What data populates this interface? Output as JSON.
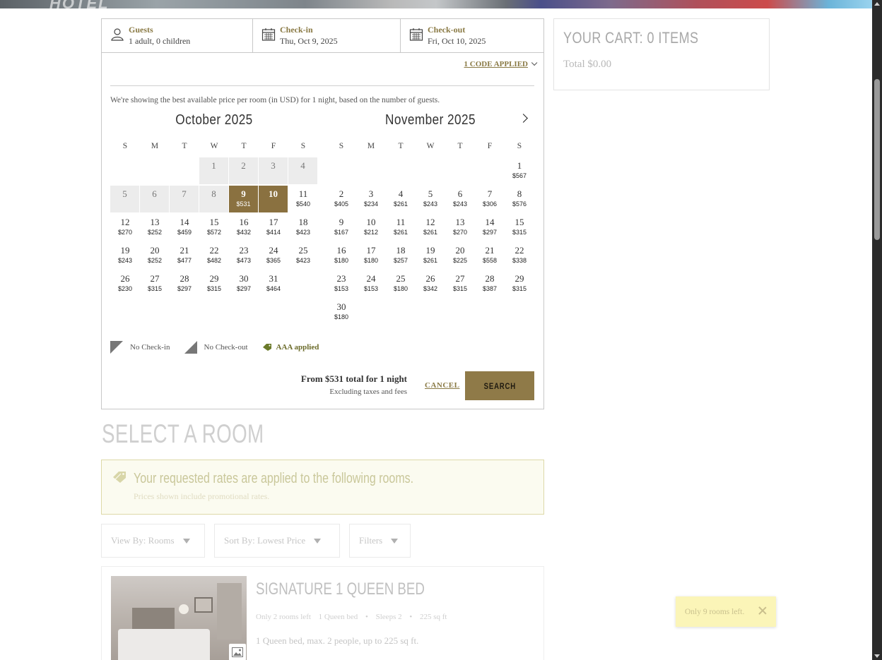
{
  "hero": {
    "text": "HOTEL"
  },
  "booking": {
    "guests": {
      "label": "Guests",
      "value": "1 adult, 0 children"
    },
    "checkin": {
      "label": "Check-in",
      "value": "Thu, Oct 9, 2025"
    },
    "checkout": {
      "label": "Check-out",
      "value": "Fri, Oct 10, 2025"
    },
    "codes_link": "1 CODE APPLIED",
    "note": "We're showing the best available price per room (in USD) for 1 night, based on the number of guests.",
    "weekdays": [
      "S",
      "M",
      "T",
      "W",
      "T",
      "F",
      "S"
    ],
    "months": [
      {
        "title": "October 2025",
        "lead_blanks": 3,
        "days": [
          {
            "n": "1",
            "p": "",
            "state": "past"
          },
          {
            "n": "2",
            "p": "",
            "state": "past"
          },
          {
            "n": "3",
            "p": "",
            "state": "past"
          },
          {
            "n": "4",
            "p": "",
            "state": "past"
          },
          {
            "n": "5",
            "p": "",
            "state": "past"
          },
          {
            "n": "6",
            "p": "",
            "state": "past"
          },
          {
            "n": "7",
            "p": "",
            "state": "past"
          },
          {
            "n": "8",
            "p": "",
            "state": "past"
          },
          {
            "n": "9",
            "p": "$531",
            "state": "sel"
          },
          {
            "n": "10",
            "p": "",
            "state": "sel"
          },
          {
            "n": "11",
            "p": "$540",
            "state": ""
          },
          {
            "n": "12",
            "p": "$270",
            "state": ""
          },
          {
            "n": "13",
            "p": "$252",
            "state": ""
          },
          {
            "n": "14",
            "p": "$459",
            "state": ""
          },
          {
            "n": "15",
            "p": "$572",
            "state": ""
          },
          {
            "n": "16",
            "p": "$432",
            "state": ""
          },
          {
            "n": "17",
            "p": "$414",
            "state": ""
          },
          {
            "n": "18",
            "p": "$423",
            "state": ""
          },
          {
            "n": "19",
            "p": "$243",
            "state": ""
          },
          {
            "n": "20",
            "p": "$252",
            "state": ""
          },
          {
            "n": "21",
            "p": "$477",
            "state": ""
          },
          {
            "n": "22",
            "p": "$482",
            "state": ""
          },
          {
            "n": "23",
            "p": "$473",
            "state": ""
          },
          {
            "n": "24",
            "p": "$365",
            "state": ""
          },
          {
            "n": "25",
            "p": "$423",
            "state": ""
          },
          {
            "n": "26",
            "p": "$230",
            "state": ""
          },
          {
            "n": "27",
            "p": "$315",
            "state": ""
          },
          {
            "n": "28",
            "p": "$297",
            "state": ""
          },
          {
            "n": "29",
            "p": "$315",
            "state": ""
          },
          {
            "n": "30",
            "p": "$297",
            "state": ""
          },
          {
            "n": "31",
            "p": "$464",
            "state": ""
          }
        ]
      },
      {
        "title": "November 2025",
        "lead_blanks": 6,
        "days": [
          {
            "n": "1",
            "p": "$567",
            "state": ""
          },
          {
            "n": "2",
            "p": "$405",
            "state": ""
          },
          {
            "n": "3",
            "p": "$234",
            "state": ""
          },
          {
            "n": "4",
            "p": "$261",
            "state": ""
          },
          {
            "n": "5",
            "p": "$243",
            "state": ""
          },
          {
            "n": "6",
            "p": "$243",
            "state": ""
          },
          {
            "n": "7",
            "p": "$306",
            "state": ""
          },
          {
            "n": "8",
            "p": "$576",
            "state": ""
          },
          {
            "n": "9",
            "p": "$167",
            "state": ""
          },
          {
            "n": "10",
            "p": "$212",
            "state": ""
          },
          {
            "n": "11",
            "p": "$261",
            "state": ""
          },
          {
            "n": "12",
            "p": "$261",
            "state": ""
          },
          {
            "n": "13",
            "p": "$270",
            "state": ""
          },
          {
            "n": "14",
            "p": "$297",
            "state": ""
          },
          {
            "n": "15",
            "p": "$315",
            "state": ""
          },
          {
            "n": "16",
            "p": "$180",
            "state": ""
          },
          {
            "n": "17",
            "p": "$180",
            "state": ""
          },
          {
            "n": "18",
            "p": "$257",
            "state": ""
          },
          {
            "n": "19",
            "p": "$261",
            "state": ""
          },
          {
            "n": "20",
            "p": "$225",
            "state": ""
          },
          {
            "n": "21",
            "p": "$558",
            "state": ""
          },
          {
            "n": "22",
            "p": "$338",
            "state": ""
          },
          {
            "n": "23",
            "p": "$153",
            "state": ""
          },
          {
            "n": "24",
            "p": "$153",
            "state": ""
          },
          {
            "n": "25",
            "p": "$180",
            "state": ""
          },
          {
            "n": "26",
            "p": "$342",
            "state": ""
          },
          {
            "n": "27",
            "p": "$315",
            "state": ""
          },
          {
            "n": "28",
            "p": "$387",
            "state": ""
          },
          {
            "n": "29",
            "p": "$315",
            "state": ""
          },
          {
            "n": "30",
            "p": "$180",
            "state": ""
          }
        ]
      }
    ],
    "legend": {
      "no_checkin": "No Check-in",
      "no_checkout": "No Check-out",
      "aaa": "AAA applied"
    },
    "from_text": "From $531 total for 1 night",
    "excluding_text": "Excluding taxes and fees",
    "cancel_label": "CANCEL",
    "search_label": "SEARCH"
  },
  "cart": {
    "title": "YOUR CART: 0 ITEMS",
    "total": "Total $0.00"
  },
  "select_room": {
    "heading": "SELECT A ROOM"
  },
  "promo": {
    "message": "Your requested rates are applied to the following rooms.",
    "sub": "Prices shown include promotional rates."
  },
  "filters": {
    "view_by": "View By: Rooms",
    "sort_by": "Sort By: Lowest Price",
    "filters": "Filters"
  },
  "room": {
    "title": "SIGNATURE 1 QUEEN BED",
    "availability": "Only 2 rooms left",
    "bed": "1 Queen bed",
    "sleeps": "Sleeps 2",
    "size": "225 sq ft",
    "description": "1 Queen bed, max. 2 people, up to 225 sq ft."
  },
  "toast": {
    "message": "Only 9 rooms left."
  },
  "colors": {
    "accent": "#8a7140",
    "button": "#8f7a48",
    "link": "#8a7a45",
    "past_bg": "#ececec",
    "promo_bg": "#fbfbf0",
    "toast_bg": "#fbf5b8"
  }
}
